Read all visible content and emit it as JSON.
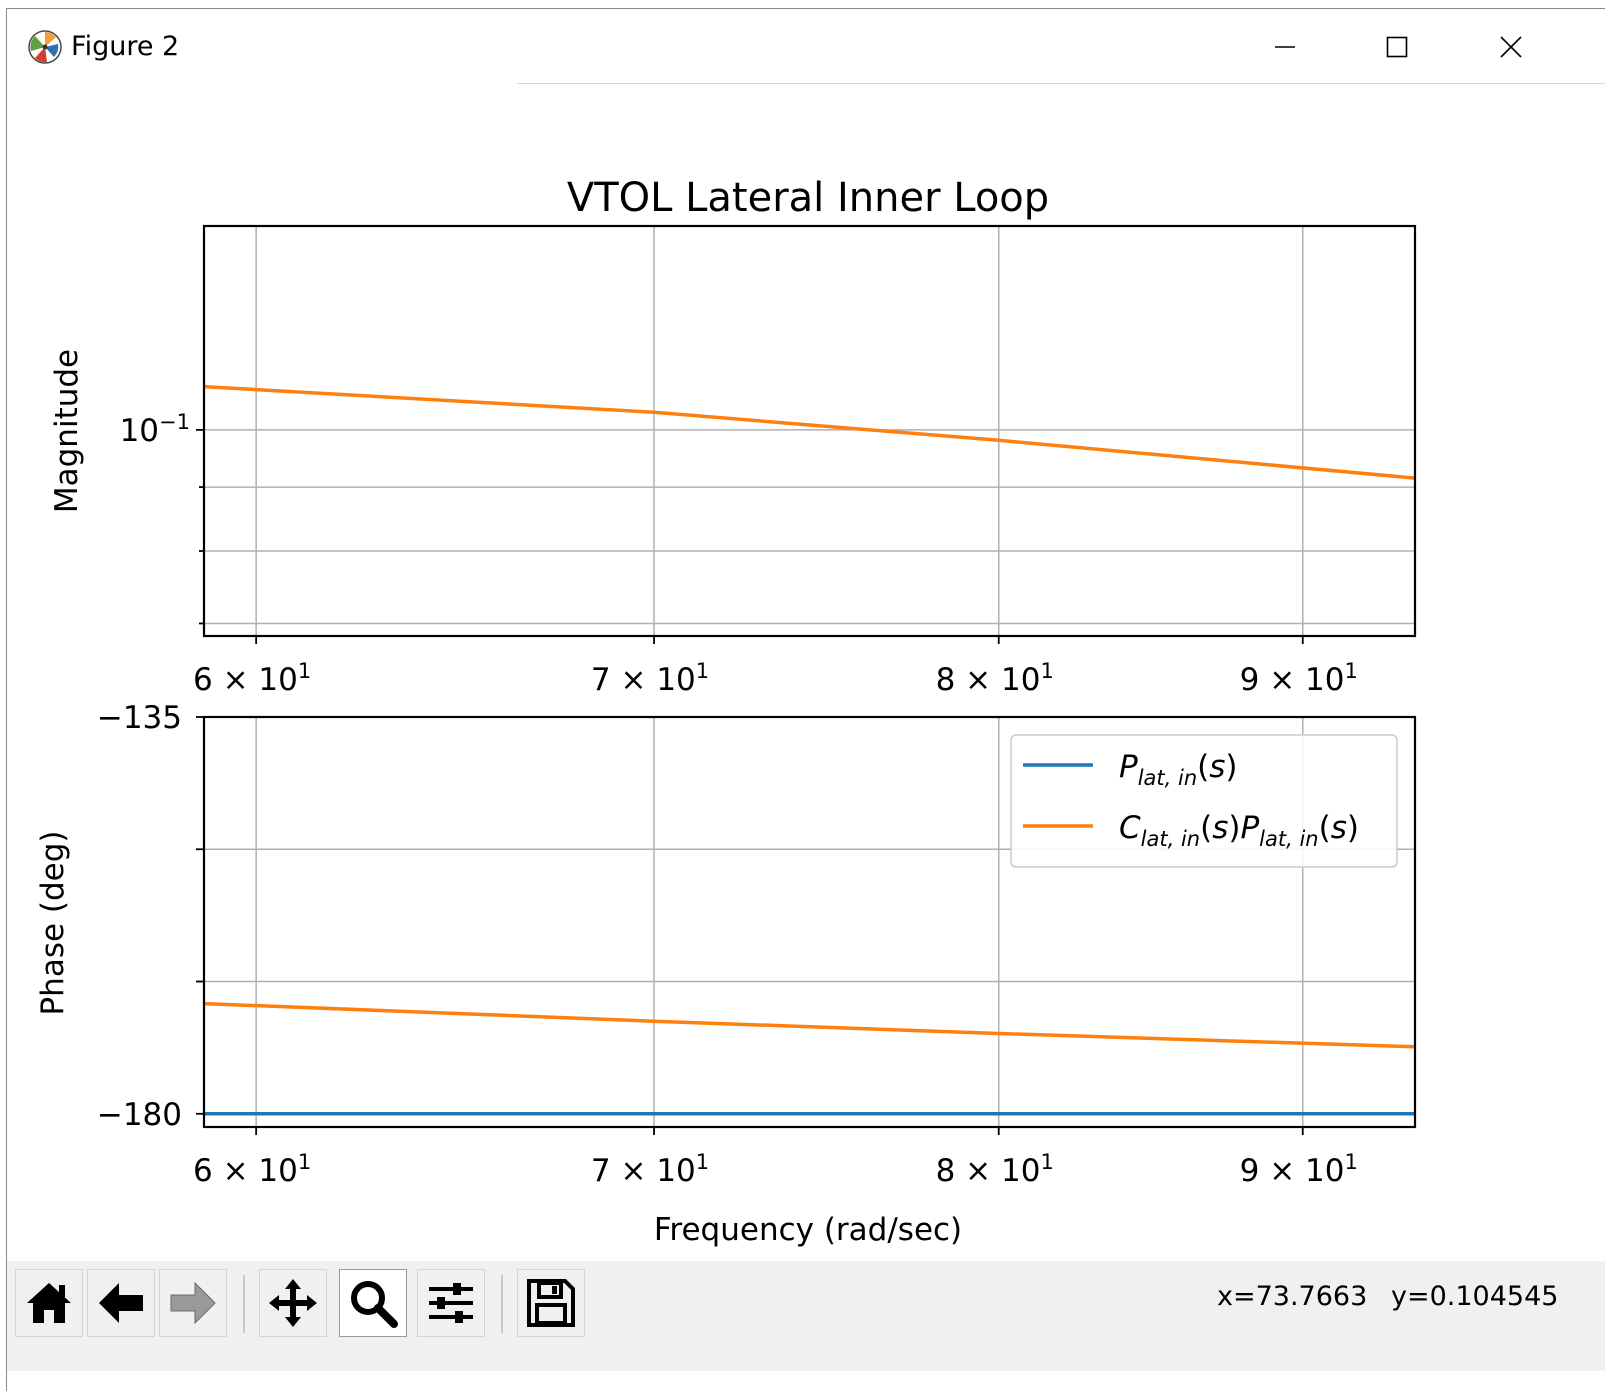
{
  "window": {
    "title": "Figure 2",
    "app_icon": "matplotlib-icon",
    "controls": [
      "minimize-icon",
      "maximize-icon",
      "close-icon"
    ]
  },
  "figure": {
    "suptitle": "VTOL Lateral Inner Loop",
    "xlabel": "Frequency (rad/sec)"
  },
  "chart_data": [
    {
      "type": "line",
      "ylabel": "Magnitude",
      "xscale": "log",
      "yscale": "log",
      "xlim": [
        58.8,
        94.0
      ],
      "ylim": [
        0.0684,
        0.1456
      ],
      "xticks": [
        60,
        70,
        80,
        90
      ],
      "xtick_labels": [
        "6 × 10¹",
        "7 × 10¹",
        "8 × 10¹",
        "9 × 10¹"
      ],
      "yticks_major": [
        0.1
      ],
      "ytick_labels": [
        "10⁻¹"
      ],
      "grid": true,
      "series": [
        {
          "name": "",
          "color": "#ff7f0e",
          "x": [
            58.8,
            70,
            80,
            94.0
          ],
          "y": [
            0.1083,
            0.1033,
            0.0981,
            0.0915
          ]
        }
      ]
    },
    {
      "type": "line",
      "ylabel": "Phase (deg)",
      "xscale": "log",
      "xlim": [
        58.8,
        94.0
      ],
      "ylim": [
        -181.5,
        -135
      ],
      "yticks": [
        -135,
        -150,
        -165,
        -180
      ],
      "ytick_labels": [
        "−135",
        "",
        "",
        "−180"
      ],
      "xticks": [
        60,
        70,
        80,
        90
      ],
      "xtick_labels": [
        "6 × 10¹",
        "7 × 10¹",
        "8 × 10¹",
        "9 × 10¹"
      ],
      "grid": true,
      "legend_position": "upper right",
      "series": [
        {
          "name": "P_lat,in(s)",
          "color": "#1f77b4",
          "x": [
            58.8,
            94.0
          ],
          "y": [
            -180.0,
            -180.0
          ]
        },
        {
          "name": "C_lat,in(s)P_lat,in(s)",
          "color": "#ff7f0e",
          "x": [
            58.8,
            70,
            80,
            94.0
          ],
          "y": [
            -167.5,
            -169.5,
            -170.9,
            -172.4
          ]
        }
      ]
    }
  ],
  "toolbar": {
    "buttons": [
      {
        "name": "home-button",
        "icon": "home-icon",
        "active": false
      },
      {
        "name": "back-button",
        "icon": "arrow-left-icon",
        "active": false
      },
      {
        "name": "forward-button",
        "icon": "arrow-right-icon",
        "active": false
      },
      {
        "name": "pan-button",
        "icon": "move-icon",
        "active": false
      },
      {
        "name": "zoom-button",
        "icon": "magnifier-icon",
        "active": true
      },
      {
        "name": "subplots-button",
        "icon": "sliders-icon",
        "active": false
      },
      {
        "name": "save-button",
        "icon": "floppy-disk-icon",
        "active": false
      }
    ],
    "coord_x": "x=73.7663",
    "coord_y": "y=0.104545"
  }
}
